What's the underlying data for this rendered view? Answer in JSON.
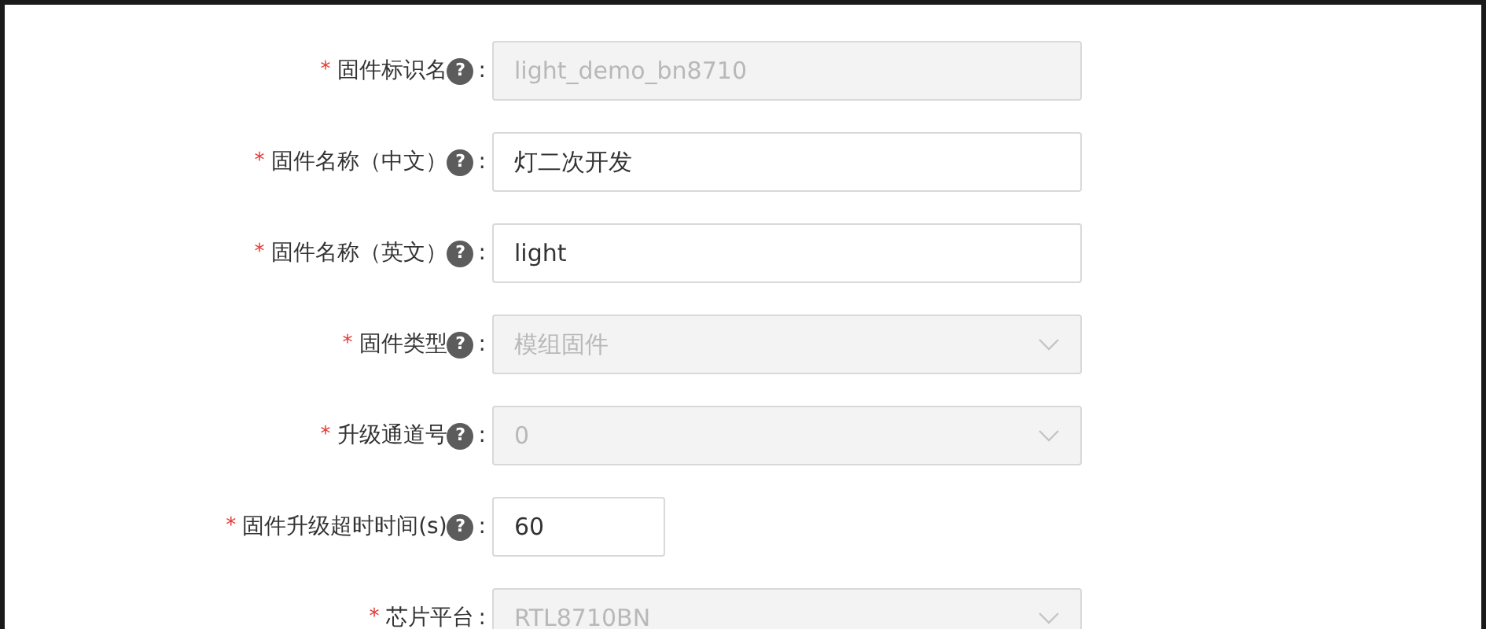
{
  "fields": [
    {
      "label": "固件标识名",
      "required": true,
      "help": true,
      "kind": "text",
      "disabled": true,
      "value": "light_demo_bn8710"
    },
    {
      "label": "固件名称（中文）",
      "required": true,
      "help": true,
      "kind": "text",
      "disabled": false,
      "value": "灯二次开发"
    },
    {
      "label": "固件名称（英文）",
      "required": true,
      "help": true,
      "kind": "text",
      "disabled": false,
      "value": "light"
    },
    {
      "label": "固件类型",
      "required": true,
      "help": true,
      "kind": "select",
      "disabled": true,
      "value": "模组固件"
    },
    {
      "label": "升级通道号",
      "required": true,
      "help": true,
      "kind": "select",
      "disabled": true,
      "value": "0"
    },
    {
      "label": "固件升级超时时间(s)",
      "required": true,
      "help": true,
      "kind": "number",
      "disabled": false,
      "value": "60"
    },
    {
      "label": "芯片平台",
      "required": true,
      "help": false,
      "kind": "select",
      "disabled": true,
      "value": "RTL8710BN"
    }
  ],
  "colon": ":",
  "required_mark": "*",
  "help_mark": "?"
}
